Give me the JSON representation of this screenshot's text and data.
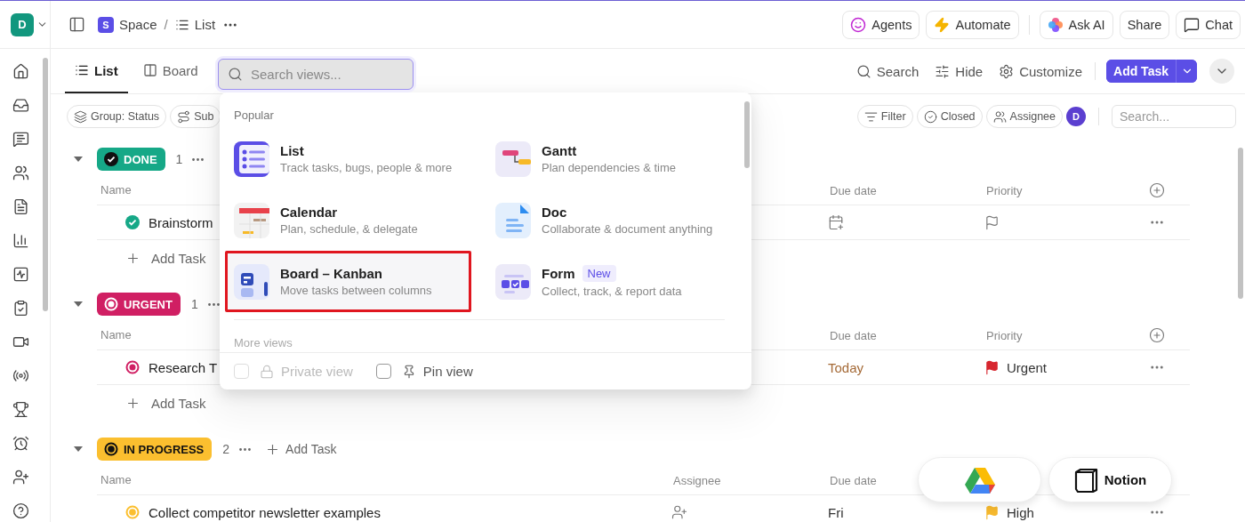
{
  "workspace": {
    "avatar": "D"
  },
  "breadcrumb": {
    "space_badge": "S",
    "space": "Space",
    "separator": "/",
    "view": "List"
  },
  "top_actions": [
    {
      "label": "Agents",
      "kind": "agents"
    },
    {
      "label": "Automate",
      "kind": "automate"
    },
    {
      "label": "Ask AI",
      "kind": "ask_ai"
    },
    {
      "label": "Share",
      "kind": "share"
    },
    {
      "label": "Chat",
      "kind": "chat"
    }
  ],
  "view_tabs": [
    {
      "label": "List",
      "kind": "list",
      "selected": true
    },
    {
      "label": "Board",
      "kind": "board",
      "selected": false
    }
  ],
  "view_search": {
    "placeholder": "Search views..."
  },
  "view_actions": [
    {
      "label": "Search",
      "kind": "search"
    },
    {
      "label": "Hide",
      "kind": "hide"
    },
    {
      "label": "Customize",
      "kind": "customize"
    }
  ],
  "add_task_button": "Add Task",
  "filter_chips_left": [
    {
      "label": "Group: Status",
      "kind": "group"
    },
    {
      "label": "Sub",
      "kind": "subtasks"
    }
  ],
  "filter_chips_right": [
    {
      "label": "Filter",
      "kind": "filter"
    },
    {
      "label": "Closed",
      "kind": "closed"
    },
    {
      "label": "Assignee",
      "kind": "assignee"
    }
  ],
  "assignee_avatar": "D",
  "list_search": {
    "placeholder": "Search..."
  },
  "groups": [
    {
      "status": "DONE",
      "kind": "done",
      "color": "#16a887",
      "expanded": true,
      "count": "1",
      "columns": {
        "name": "Name",
        "due_date": "Due date",
        "priority": "Priority"
      },
      "add_column": true,
      "rows": [
        {
          "name": "Brainstorm",
          "due": {
            "kind": "empty"
          },
          "priority": {
            "kind": "empty"
          }
        }
      ],
      "add_task": "Add Task"
    },
    {
      "status": "URGENT",
      "kind": "urgent",
      "color": "#d01f63",
      "expanded": true,
      "count": "1",
      "columns": {
        "name": "Name",
        "due_date": "Due date",
        "priority": "Priority"
      },
      "add_column": true,
      "rows": [
        {
          "name": "Research T",
          "due": {
            "kind": "today",
            "text": "Today"
          },
          "priority": {
            "kind": "urgent",
            "label": "Urgent"
          }
        }
      ],
      "add_task": "Add Task"
    },
    {
      "status": "IN PROGRESS",
      "kind": "in_progress",
      "color": "#fbbf2f",
      "expanded": true,
      "count": "2",
      "header_add_task": "Add Task",
      "columns": {
        "name": "Name",
        "assignee": "Assignee",
        "due_date": "Due date"
      },
      "add_column": false,
      "rows": [
        {
          "name": "Collect competitor newsletter examples",
          "assignee": {
            "kind": "empty"
          },
          "due": {
            "kind": "normal",
            "text": "Fri"
          },
          "priority": {
            "kind": "high",
            "label": "High"
          }
        }
      ]
    }
  ],
  "views_popover": {
    "section": "Popular",
    "items": [
      {
        "kind": "list",
        "title": "List",
        "description": "Track tasks, bugs, people & more",
        "highlighted": false
      },
      {
        "kind": "gantt",
        "title": "Gantt",
        "description": "Plan dependencies & time",
        "highlighted": false
      },
      {
        "kind": "calendar",
        "title": "Calendar",
        "description": "Plan, schedule, & delegate",
        "highlighted": false
      },
      {
        "kind": "doc",
        "title": "Doc",
        "description": "Collaborate & document anything",
        "highlighted": false
      },
      {
        "kind": "board",
        "title": "Board – Kanban",
        "description": "Move tasks between columns",
        "highlighted": true
      },
      {
        "kind": "form",
        "title": "Form",
        "badge": "New",
        "description": "Collect, track, & report data",
        "highlighted": false
      }
    ],
    "more_section": "More views",
    "options": [
      {
        "kind": "private",
        "label": "Private view",
        "checked": false,
        "disabled": true
      },
      {
        "kind": "pin",
        "label": "Pin view",
        "checked": false,
        "disabled": false
      }
    ]
  },
  "integrations": [
    {
      "kind": "drive"
    },
    {
      "kind": "notion",
      "label": "Notion"
    }
  ]
}
